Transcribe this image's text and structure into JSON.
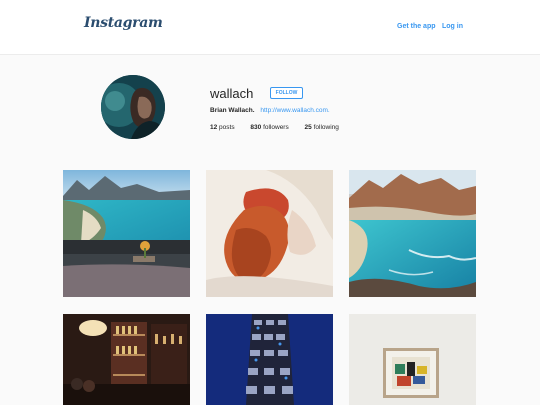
{
  "header": {
    "logo_text": "Instagram",
    "get_app_label": "Get the app",
    "login_label": "Log in"
  },
  "profile": {
    "username": "wallach",
    "follow_label": "FOLLOW",
    "full_name": "Brian Wallach.",
    "website": "http://www.wallach.com.",
    "posts_count": "12",
    "posts_label": "posts",
    "followers_count": "830",
    "followers_label": "followers",
    "following_count": "25",
    "following_label": "following"
  },
  "colors": {
    "link_blue": "#3897f0",
    "logo": "#2b4d6f"
  },
  "posts": [
    {
      "subject": "coastal bay with terrace and flowers"
    },
    {
      "subject": "red-haired woman lying on white sheets"
    },
    {
      "subject": "aerial view of turquoise coast and mountains"
    },
    {
      "subject": "dim bar with shelves of bottles"
    },
    {
      "subject": "stacked radios tower installation"
    },
    {
      "subject": "framed abstract painting on wall"
    }
  ]
}
